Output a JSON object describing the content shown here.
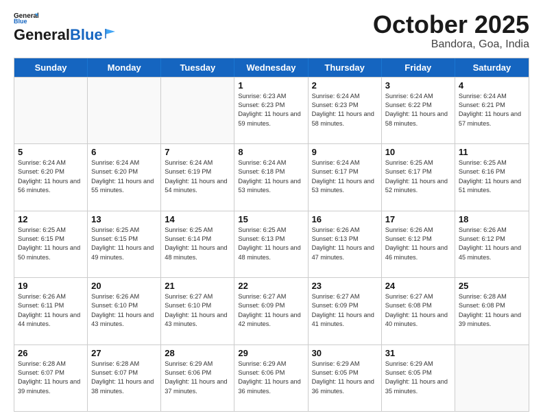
{
  "header": {
    "logo_line1": "General",
    "logo_line2": "Blue",
    "month": "October 2025",
    "location": "Bandora, Goa, India"
  },
  "days_of_week": [
    "Sunday",
    "Monday",
    "Tuesday",
    "Wednesday",
    "Thursday",
    "Friday",
    "Saturday"
  ],
  "weeks": [
    [
      {
        "day": "",
        "info": ""
      },
      {
        "day": "",
        "info": ""
      },
      {
        "day": "",
        "info": ""
      },
      {
        "day": "1",
        "info": "Sunrise: 6:23 AM\nSunset: 6:23 PM\nDaylight: 11 hours\nand 59 minutes."
      },
      {
        "day": "2",
        "info": "Sunrise: 6:24 AM\nSunset: 6:23 PM\nDaylight: 11 hours\nand 58 minutes."
      },
      {
        "day": "3",
        "info": "Sunrise: 6:24 AM\nSunset: 6:22 PM\nDaylight: 11 hours\nand 58 minutes."
      },
      {
        "day": "4",
        "info": "Sunrise: 6:24 AM\nSunset: 6:21 PM\nDaylight: 11 hours\nand 57 minutes."
      }
    ],
    [
      {
        "day": "5",
        "info": "Sunrise: 6:24 AM\nSunset: 6:20 PM\nDaylight: 11 hours\nand 56 minutes."
      },
      {
        "day": "6",
        "info": "Sunrise: 6:24 AM\nSunset: 6:20 PM\nDaylight: 11 hours\nand 55 minutes."
      },
      {
        "day": "7",
        "info": "Sunrise: 6:24 AM\nSunset: 6:19 PM\nDaylight: 11 hours\nand 54 minutes."
      },
      {
        "day": "8",
        "info": "Sunrise: 6:24 AM\nSunset: 6:18 PM\nDaylight: 11 hours\nand 53 minutes."
      },
      {
        "day": "9",
        "info": "Sunrise: 6:24 AM\nSunset: 6:17 PM\nDaylight: 11 hours\nand 53 minutes."
      },
      {
        "day": "10",
        "info": "Sunrise: 6:25 AM\nSunset: 6:17 PM\nDaylight: 11 hours\nand 52 minutes."
      },
      {
        "day": "11",
        "info": "Sunrise: 6:25 AM\nSunset: 6:16 PM\nDaylight: 11 hours\nand 51 minutes."
      }
    ],
    [
      {
        "day": "12",
        "info": "Sunrise: 6:25 AM\nSunset: 6:15 PM\nDaylight: 11 hours\nand 50 minutes."
      },
      {
        "day": "13",
        "info": "Sunrise: 6:25 AM\nSunset: 6:15 PM\nDaylight: 11 hours\nand 49 minutes."
      },
      {
        "day": "14",
        "info": "Sunrise: 6:25 AM\nSunset: 6:14 PM\nDaylight: 11 hours\nand 48 minutes."
      },
      {
        "day": "15",
        "info": "Sunrise: 6:25 AM\nSunset: 6:13 PM\nDaylight: 11 hours\nand 48 minutes."
      },
      {
        "day": "16",
        "info": "Sunrise: 6:26 AM\nSunset: 6:13 PM\nDaylight: 11 hours\nand 47 minutes."
      },
      {
        "day": "17",
        "info": "Sunrise: 6:26 AM\nSunset: 6:12 PM\nDaylight: 11 hours\nand 46 minutes."
      },
      {
        "day": "18",
        "info": "Sunrise: 6:26 AM\nSunset: 6:12 PM\nDaylight: 11 hours\nand 45 minutes."
      }
    ],
    [
      {
        "day": "19",
        "info": "Sunrise: 6:26 AM\nSunset: 6:11 PM\nDaylight: 11 hours\nand 44 minutes."
      },
      {
        "day": "20",
        "info": "Sunrise: 6:26 AM\nSunset: 6:10 PM\nDaylight: 11 hours\nand 43 minutes."
      },
      {
        "day": "21",
        "info": "Sunrise: 6:27 AM\nSunset: 6:10 PM\nDaylight: 11 hours\nand 43 minutes."
      },
      {
        "day": "22",
        "info": "Sunrise: 6:27 AM\nSunset: 6:09 PM\nDaylight: 11 hours\nand 42 minutes."
      },
      {
        "day": "23",
        "info": "Sunrise: 6:27 AM\nSunset: 6:09 PM\nDaylight: 11 hours\nand 41 minutes."
      },
      {
        "day": "24",
        "info": "Sunrise: 6:27 AM\nSunset: 6:08 PM\nDaylight: 11 hours\nand 40 minutes."
      },
      {
        "day": "25",
        "info": "Sunrise: 6:28 AM\nSunset: 6:08 PM\nDaylight: 11 hours\nand 39 minutes."
      }
    ],
    [
      {
        "day": "26",
        "info": "Sunrise: 6:28 AM\nSunset: 6:07 PM\nDaylight: 11 hours\nand 39 minutes."
      },
      {
        "day": "27",
        "info": "Sunrise: 6:28 AM\nSunset: 6:07 PM\nDaylight: 11 hours\nand 38 minutes."
      },
      {
        "day": "28",
        "info": "Sunrise: 6:29 AM\nSunset: 6:06 PM\nDaylight: 11 hours\nand 37 minutes."
      },
      {
        "day": "29",
        "info": "Sunrise: 6:29 AM\nSunset: 6:06 PM\nDaylight: 11 hours\nand 36 minutes."
      },
      {
        "day": "30",
        "info": "Sunrise: 6:29 AM\nSunset: 6:05 PM\nDaylight: 11 hours\nand 36 minutes."
      },
      {
        "day": "31",
        "info": "Sunrise: 6:29 AM\nSunset: 6:05 PM\nDaylight: 11 hours\nand 35 minutes."
      },
      {
        "day": "",
        "info": ""
      }
    ]
  ]
}
